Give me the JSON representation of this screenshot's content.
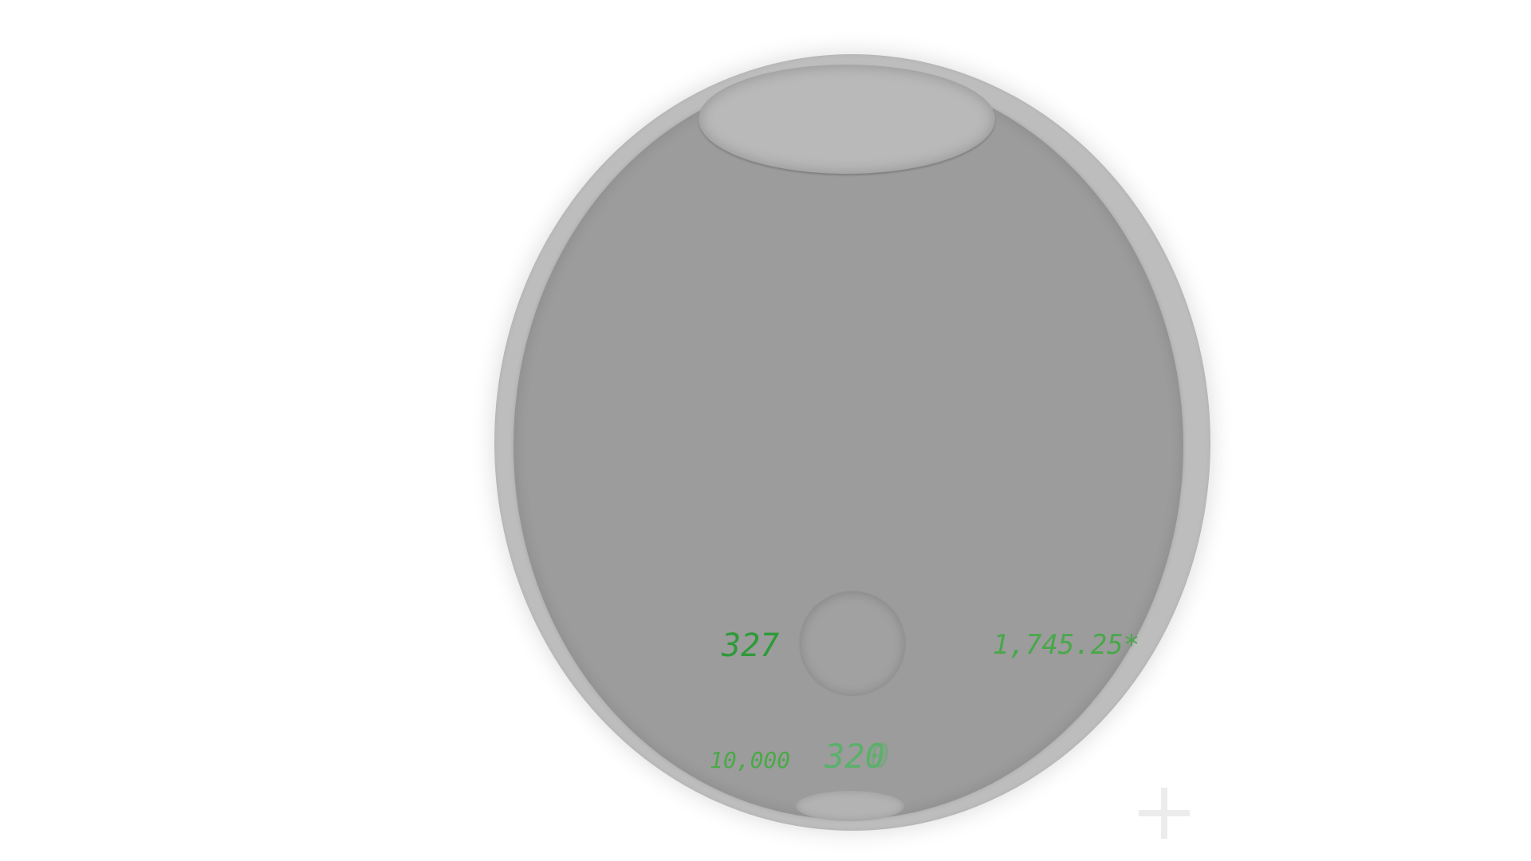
{
  "readouts": {
    "left_value": "327",
    "right_value": "1,745.25*",
    "bottom_left_value": "10,000",
    "bottom_center_value": "320",
    "bottom_center_overlay": "0"
  },
  "icons": {
    "plus": "plus-icon"
  },
  "colors": {
    "background": "#ffffff",
    "device_rim": "#bdbdbd",
    "device_face": "#9c9c9c",
    "lcd_green": "#2f9a3a",
    "lcd_green_light": "#48a84a"
  }
}
